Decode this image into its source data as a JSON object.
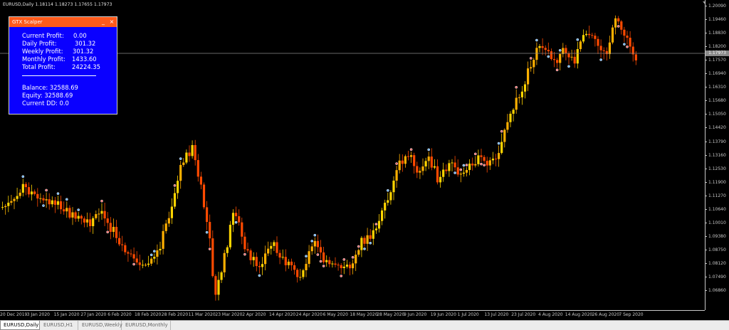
{
  "chart": {
    "header": "EURUSD,Daily  1.18114 1.18273 1.17655 1.17973",
    "symbol": "EURUSD",
    "timeframe": "Daily",
    "current_price": "1.17973",
    "price_labels": [
      "1.20090",
      "1.19460",
      "1.18830",
      "1.18200",
      "1.17570",
      "1.16940",
      "1.16310",
      "1.15680",
      "1.15050",
      "1.14420",
      "1.13790",
      "1.13160",
      "1.12530",
      "1.11900",
      "1.11270",
      "1.10640",
      "1.10010",
      "1.09380",
      "1.08750",
      "1.08120",
      "1.07490",
      "1.06860"
    ],
    "date_labels": [
      "20 Dec 2019",
      "3 Jan 2020",
      "15 Jan 2020",
      "27 Jan 2020",
      "6 Feb 2020",
      "18 Feb 2020",
      "28 Feb 2020",
      "11 Mar 2020",
      "23 Mar 2020",
      "2 Apr 2020",
      "14 Apr 2020",
      "24 Apr 2020",
      "6 May 2020",
      "18 May 2020",
      "28 May 2020",
      "9 Jun 2020",
      "19 Jun 2020",
      "1 Jul 2020",
      "13 Jul 2020",
      "23 Jul 2020",
      "4 Aug 2020",
      "14 Aug 2020",
      "26 Aug 2020",
      "7 Sep 2020"
    ],
    "colors": {
      "bull": "#ffb000",
      "bull_alt": "#ffd400",
      "bear": "#ff4a00",
      "grid_label": "#c8c8c8",
      "price_line": "#8a8a8a"
    }
  },
  "ea_panel": {
    "title": "GTX Scalper",
    "minimize": "_",
    "close": "×",
    "rows": [
      {
        "label": "Current Profit:",
        "value": "0.00"
      },
      {
        "label": "Daily Profit:",
        "value": "301.32"
      },
      {
        "label": "Weekly Profit:",
        "value": "301.32"
      },
      {
        "label": "Monthly Profit:",
        "value": "1433.60"
      },
      {
        "label": "Total Profit:",
        "value": "24224.35"
      }
    ],
    "divider": "____________________",
    "account": [
      "Balance: 32588.69",
      "Equity: 32588.69",
      "Current DD: 0.0"
    ],
    "colors": {
      "background": "#0a00ff",
      "titlebar": "#ff5a1a"
    }
  },
  "tabs": [
    {
      "label": "EURUSD,Daily",
      "active": true
    },
    {
      "label": "EURUSD,H1",
      "active": false
    },
    {
      "label": "EURUSD,Weekly",
      "active": false
    },
    {
      "label": "EURUSD,Monthly",
      "active": false
    }
  ]
}
